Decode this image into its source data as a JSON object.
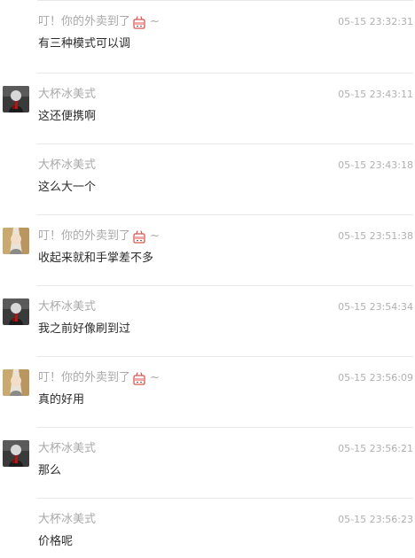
{
  "messages": [
    {
      "avatar": "",
      "avatar_style": "none",
      "nickname": "叮！你的外卖到了",
      "nickname_emoji": "takeout-box-emoji",
      "nickname_suffix": "~",
      "time": "05-15 23:32:31",
      "text": "有三种模式可以调"
    },
    {
      "avatar": "profile-avatar",
      "avatar_style": "dark-figure",
      "nickname": "大杯冰美式",
      "nickname_emoji": "",
      "nickname_suffix": "",
      "time": "05-15 23:43:11",
      "text": "这还便携啊"
    },
    {
      "avatar": "",
      "avatar_style": "none",
      "nickname": "大杯冰美式",
      "nickname_emoji": "",
      "nickname_suffix": "",
      "time": "05-15 23:43:18",
      "text": "这么大一个"
    },
    {
      "avatar": "profile-avatar",
      "avatar_style": "light-portrait",
      "nickname": "叮！你的外卖到了",
      "nickname_emoji": "takeout-box-emoji",
      "nickname_suffix": "~",
      "time": "05-15 23:51:38",
      "text": "收起来就和手掌差不多"
    },
    {
      "avatar": "profile-avatar",
      "avatar_style": "dark-figure",
      "nickname": "大杯冰美式",
      "nickname_emoji": "",
      "nickname_suffix": "",
      "time": "05-15 23:54:34",
      "text": "我之前好像刷到过"
    },
    {
      "avatar": "profile-avatar",
      "avatar_style": "light-portrait",
      "nickname": "叮！你的外卖到了",
      "nickname_emoji": "takeout-box-emoji",
      "nickname_suffix": "~",
      "time": "05-15 23:56:09",
      "text": "真的好用"
    },
    {
      "avatar": "profile-avatar",
      "avatar_style": "dark-figure",
      "nickname": "大杯冰美式",
      "nickname_emoji": "",
      "nickname_suffix": "",
      "time": "05-15 23:56:21",
      "text": "那么"
    },
    {
      "avatar": "",
      "avatar_style": "none",
      "nickname": "大杯冰美式",
      "nickname_emoji": "",
      "nickname_suffix": "",
      "time": "05-15 23:56:23",
      "text": "价格呢"
    }
  ],
  "colors": {
    "nickname": "#a9a9a9",
    "timestamp": "#b0b0b0",
    "message_text": "#2b2b2b",
    "divider": "#e8e8e8"
  }
}
